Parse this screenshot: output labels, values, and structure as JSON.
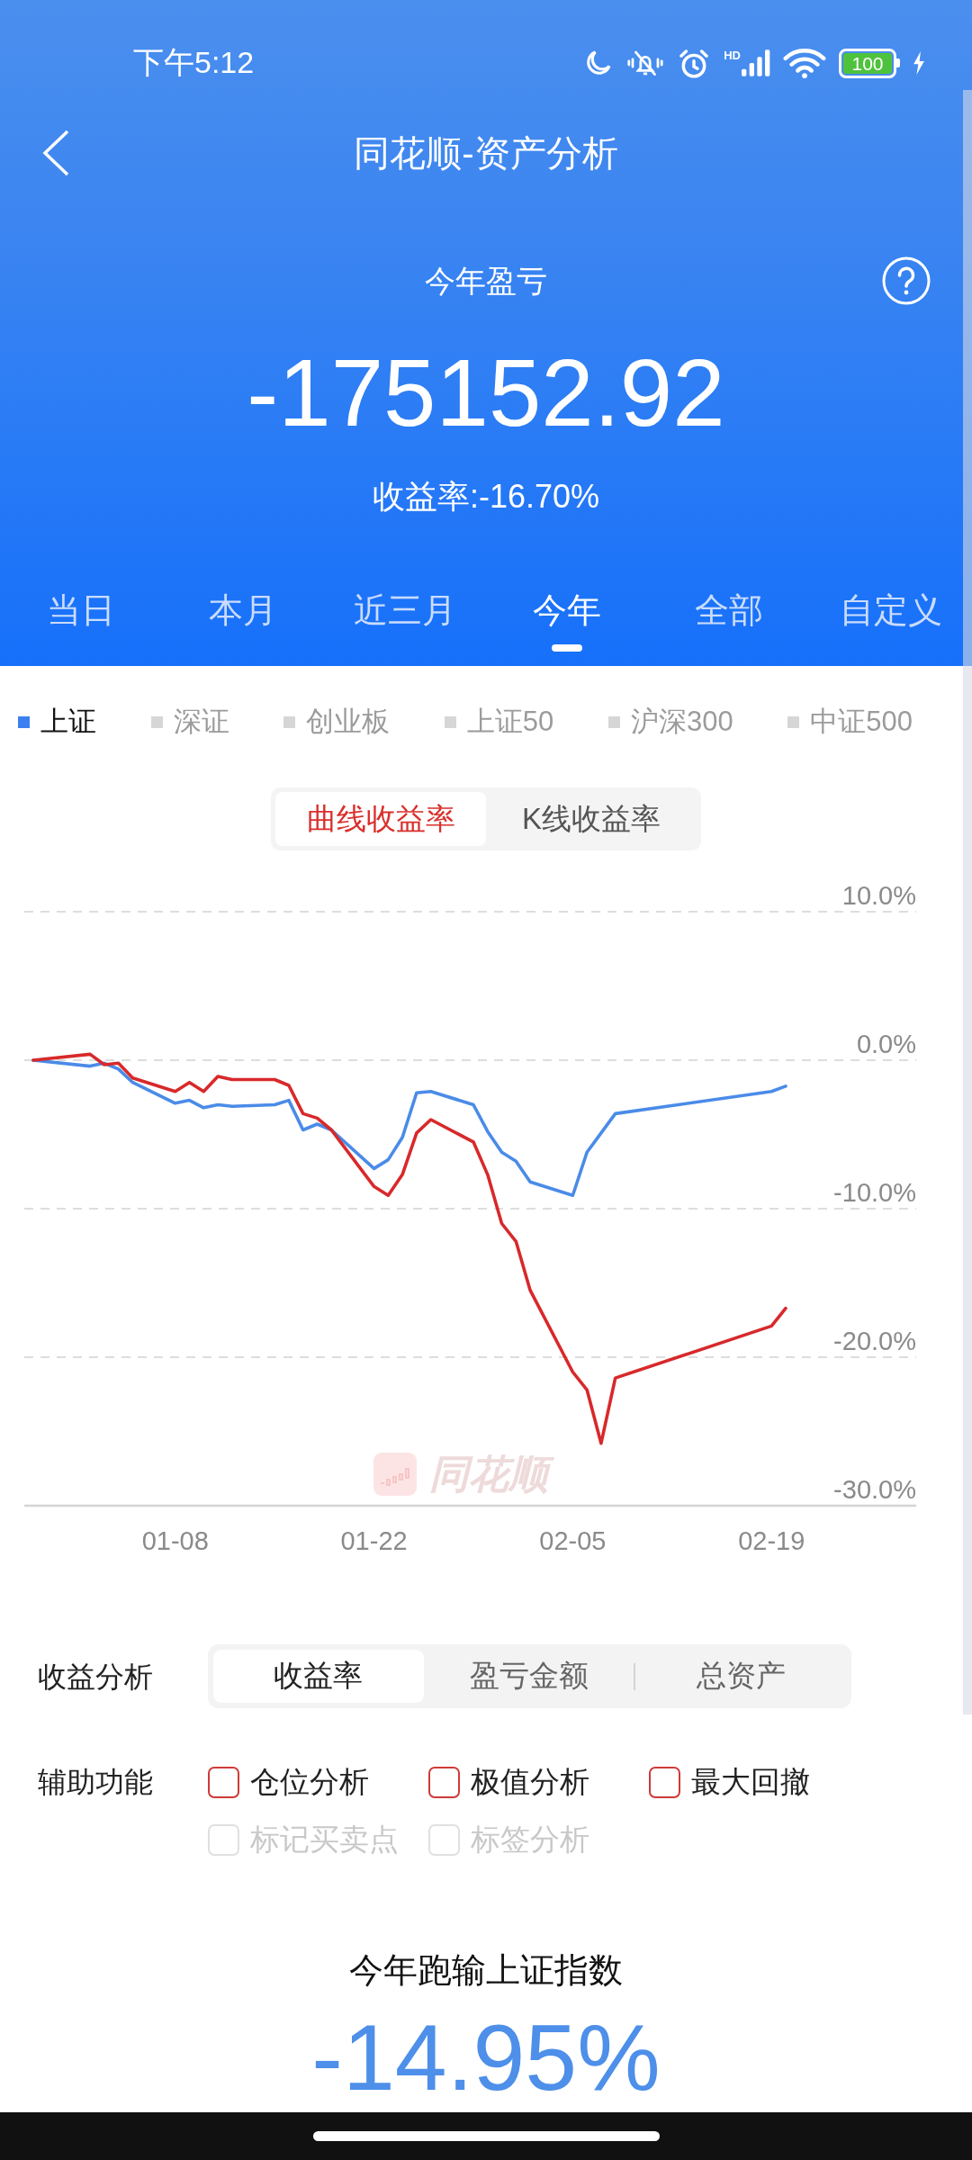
{
  "status_bar": {
    "time": "下午5:12",
    "network_type": "HD",
    "battery": "100"
  },
  "header": {
    "title": "同花顺-资产分析"
  },
  "summary": {
    "label": "今年盈亏",
    "amount": "-175152.92",
    "return_rate": "收益率:-16.70%"
  },
  "period_tabs": [
    {
      "label": "当日",
      "selected": false
    },
    {
      "label": "本月",
      "selected": false
    },
    {
      "label": "近三月",
      "selected": false
    },
    {
      "label": "今年",
      "selected": true
    },
    {
      "label": "全部",
      "selected": false
    },
    {
      "label": "自定义",
      "selected": false
    }
  ],
  "index_legend": [
    {
      "label": "上证",
      "selected": true
    },
    {
      "label": "深证",
      "selected": false
    },
    {
      "label": "创业板",
      "selected": false
    },
    {
      "label": "上证50",
      "selected": false
    },
    {
      "label": "沪深300",
      "selected": false
    },
    {
      "label": "中证500",
      "selected": false
    }
  ],
  "chart_mode": [
    {
      "label": "曲线收益率",
      "selected": true
    },
    {
      "label": "K线收益率",
      "selected": false
    }
  ],
  "chart": {
    "watermark": "同花顺",
    "chart_data": {
      "type": "line",
      "grid": true,
      "categories": [
        null,
        null,
        null,
        null,
        null,
        null,
        null,
        null,
        null,
        null,
        "01-08",
        null,
        null,
        null,
        null,
        null,
        null,
        null,
        null,
        null,
        null,
        null,
        null,
        null,
        "01-22",
        null,
        null,
        null,
        null,
        null,
        null,
        null,
        null,
        null,
        null,
        null,
        null,
        null,
        "02-05",
        null,
        null,
        null,
        null,
        null,
        null,
        null,
        null,
        null,
        null,
        null,
        null,
        null,
        "02-19",
        null
      ],
      "series": [
        {
          "color": "#d8292b",
          "values": [
            0,
            null,
            null,
            null,
            0.4,
            -0.3,
            -0.2,
            -1.2,
            null,
            null,
            -2.1,
            -1.5,
            -2.1,
            -1.1,
            -1.3,
            null,
            null,
            -1.3,
            -1.7,
            -3.6,
            -3.9,
            -4.7,
            null,
            null,
            -8.5,
            -9.1,
            -7.7,
            -4.9,
            -4.0,
            null,
            null,
            -5.5,
            -7.7,
            -11.0,
            -12.2,
            -15.5,
            null,
            null,
            -21.0,
            -22.2,
            -25.8,
            -21.4,
            null,
            null,
            null,
            null,
            null,
            null,
            null,
            null,
            null,
            null,
            -17.9,
            -16.7
          ]
        },
        {
          "color": "#4a8be8",
          "values": [
            0,
            null,
            null,
            null,
            -0.4,
            -0.2,
            -0.6,
            -1.5,
            null,
            null,
            -2.9,
            -2.7,
            -3.2,
            -3.0,
            -3.1,
            null,
            null,
            -3.0,
            -2.7,
            -4.7,
            -4.3,
            -4.7,
            null,
            null,
            -7.3,
            -6.7,
            -5.2,
            -2.2,
            -2.1,
            null,
            null,
            -3.0,
            -4.8,
            -6.2,
            -6.8,
            -8.2,
            null,
            null,
            -9.1,
            -6.2,
            -4.9,
            -3.6,
            null,
            null,
            null,
            null,
            null,
            null,
            null,
            null,
            null,
            null,
            -2.1,
            -1.75
          ]
        }
      ],
      "ylim": [
        -30,
        10
      ],
      "yticks": [
        {
          "value": 10,
          "label": "10.0%"
        },
        {
          "value": 0,
          "label": "0.0%"
        },
        {
          "value": -10,
          "label": "-10.0%"
        },
        {
          "value": -20,
          "label": "-20.0%"
        },
        {
          "value": -30,
          "label": "-30.0%"
        }
      ]
    }
  },
  "return_analysis": {
    "label": "收益分析",
    "options": [
      {
        "label": "收益率",
        "selected": true
      },
      {
        "label": "盈亏金额",
        "selected": false
      },
      {
        "label": "总资产",
        "selected": false
      }
    ]
  },
  "aux_functions": {
    "label": "辅助功能",
    "items": [
      {
        "label": "仓位分析",
        "checked": false,
        "disabled": false
      },
      {
        "label": "极值分析",
        "checked": false,
        "disabled": false
      },
      {
        "label": "最大回撤",
        "checked": false,
        "disabled": false
      },
      {
        "label": "标记买卖点",
        "checked": false,
        "disabled": true
      },
      {
        "label": "标签分析",
        "checked": false,
        "disabled": true
      }
    ]
  },
  "comparison": {
    "title": "今年跑输上证指数",
    "value": "-14.95%"
  }
}
